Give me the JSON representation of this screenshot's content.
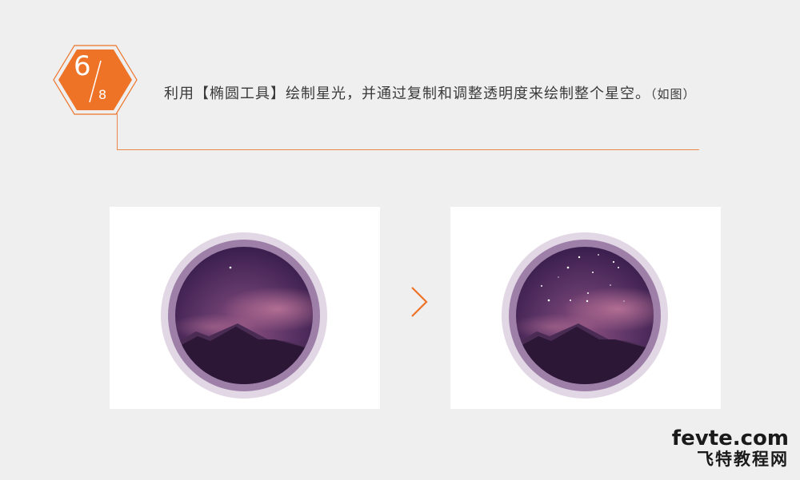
{
  "step": {
    "current": "6",
    "total": "8"
  },
  "instruction": {
    "main": "利用【椭圆工具】绘制星光，并通过复制和调整透明度来绘制整个星空。",
    "note": "（如图）"
  },
  "colors": {
    "accent": "#ee7327",
    "background": "#efefef",
    "outer_ring": "#e2d7e5",
    "inner_ring": "#9d7fa8",
    "sky_top": "#3d1f4f",
    "sky_mid": "#6a3b70",
    "glow": "#b06a8c",
    "mountain_back": "#4a2b53",
    "mountain_front": "#2c1736"
  },
  "icons": {
    "badge": "hexagon-step-badge",
    "arrow": "chevron-right-icon"
  },
  "watermark": {
    "domain": "fevte.com",
    "name": "飞特教程网"
  }
}
